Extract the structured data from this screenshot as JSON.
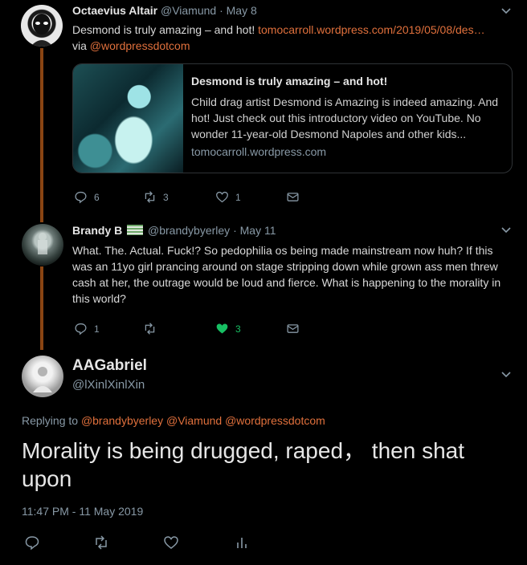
{
  "tweet1": {
    "name": "Octaevius Altair",
    "handle": "@Viamund",
    "date": "· May 8",
    "text": "Desmond is truly amazing – and hot! ",
    "link": "tomocarroll.wordpress.com/2019/05/08/des…",
    "via_prefix": "via ",
    "via_link": "@wordpressdotcom",
    "card": {
      "title": "Desmond is truly amazing – and hot!",
      "description": "Child drag artist Desmond is Amazing is indeed amazing. And hot! Just check out this introductory video on YouTube. No wonder 11-year-old Desmond Napoles and other kids...",
      "domain": "tomocarroll.wordpress.com"
    },
    "actions": {
      "replies": "6",
      "retweets": "3",
      "likes": "1"
    }
  },
  "tweet2": {
    "name": "Brandy B",
    "handle": "@brandybyerley",
    "date": "· May 11",
    "text": "What. The. Actual. Fuck!? So pedophilia os being made mainstream now huh? If this was an 11yo girl prancing around on stage stripping down while grown ass men threw cash at her, the outrage would be loud and fierce. What is happening to the morality in this world?",
    "actions": {
      "replies": "1",
      "retweets": "",
      "likes": "3"
    },
    "liked_color": "#17bf63"
  },
  "main_tweet": {
    "name": "AAGabriel",
    "handle": "@lXinlXinlXin",
    "replying_prefix": "Replying to ",
    "replying_to": "@brandybyerley @Viamund @wordpressdotcom",
    "text": "Morality is being drugged, raped， then shat upon",
    "timestamp": "11:47 PM - 11 May 2019"
  },
  "colors": {
    "background": "#000000",
    "link": "#e0703c",
    "muted": "#8899a6",
    "thread_line": "#8a4513"
  },
  "icons": [
    "reply-icon",
    "retweet-icon",
    "like-icon",
    "message-icon",
    "chevron-down-icon",
    "analytics-icon"
  ]
}
